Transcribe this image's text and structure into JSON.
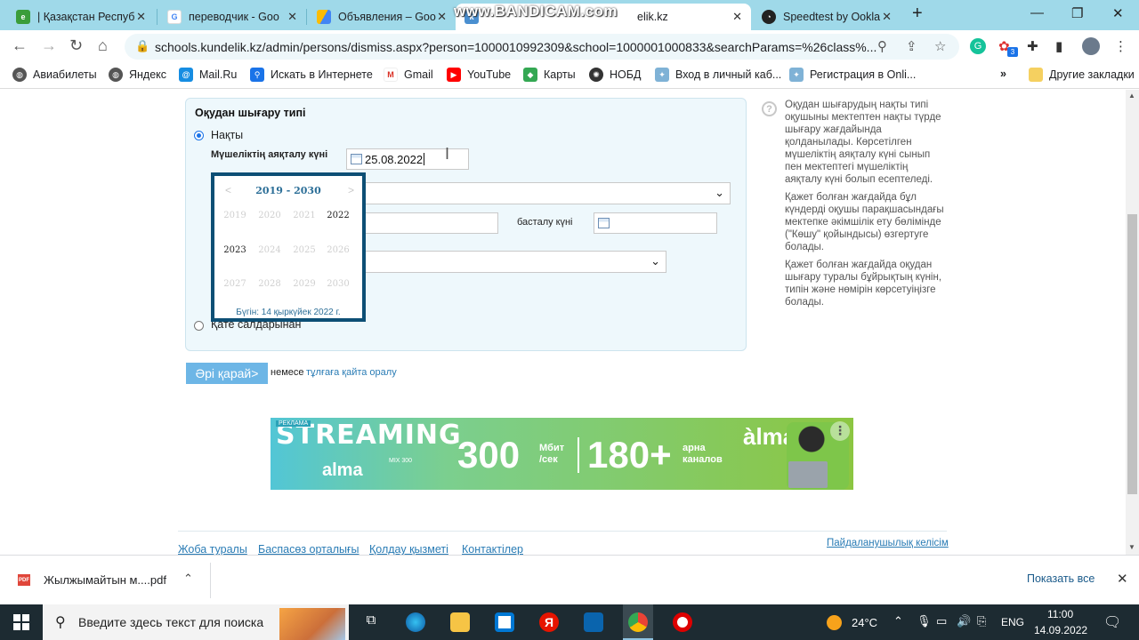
{
  "browser": {
    "tabs": [
      {
        "title": "| Қазақстан Респуб",
        "favicon": "egov-icon"
      },
      {
        "title": "переводчик - Goo",
        "favicon": "google-icon"
      },
      {
        "title": "Объявления – Goo",
        "favicon": "google-ads-icon"
      },
      {
        "title": "elik.kz",
        "favicon": "kundelik-icon"
      },
      {
        "title": "Speedtest by Ookla",
        "favicon": "speedtest-icon"
      }
    ],
    "new_tab": "+",
    "url": "schools.kundelik.kz/admin/persons/dismiss.aspx?person=1000010992309&school=1000001000833&searchParams=%26class%...",
    "extension_badge": "3",
    "bookmarks": [
      "Авиабилеты",
      "Яндекс",
      "Mail.Ru",
      "Искать в Интернете",
      "Gmail",
      "YouTube",
      "Карты",
      "НОБД",
      "Вход в личный каб...",
      "Регистрация в Onli..."
    ],
    "bookmarks_more": "»",
    "other_bookmarks": "Другие закладки"
  },
  "watermark": "www.BANDICAM.com",
  "form": {
    "section_title": "Оқудан шығару типі",
    "option_actual": "Нақты",
    "end_date_label": "Мүшеліктің аяқталу күні",
    "end_date_value": "25.08.2022",
    "start_date_label": "басталу күні",
    "start_date_value": "",
    "option_error": "Қате салдарынан",
    "next_button": "Әрі қарай>",
    "or_text": "немесе",
    "back_link": "тұлғаға қайта оралу"
  },
  "calendar": {
    "range": "2019 - 2030",
    "prev": "<",
    "next": ">",
    "years": [
      "2019",
      "2020",
      "2021",
      "2022",
      "2023",
      "2024",
      "2025",
      "2026",
      "2027",
      "2028",
      "2029",
      "2030"
    ],
    "active_years": [
      "2022",
      "2023"
    ],
    "today": "Бүгін: 14 қыркүйек 2022 г."
  },
  "help": [
    "Оқудан шығарудың нақты типі оқушыны мектептен нақты түрде шығару жағдайында қолданылады. Көрсетілген мүшеліктің аяқталу күні сынып пен мектептегі мүшеліктің аяқталу күні болып есептеледі.",
    "Қажет болған жағдайда бұл күндерді оқушы парақшасындағы мектепке әкімшілік ету бөлімінде (\"Көшу\" қойындысы) өзгертуге болады.",
    "Қажет болған жағдайда оқудан шығару туралы бұйрықтың күнін, типін және нөмірін көрсетуіңізге болады."
  ],
  "ad": {
    "tag": "РЕКЛАМА",
    "headline": "STREAMING",
    "brand": "alma",
    "mix": "MIX 300",
    "speed_value": "300",
    "speed_unit_1": "Мбит",
    "speed_unit_2": "/сек",
    "channels_value": "180+",
    "channels_unit_1": "арна",
    "channels_unit_2": "каналов",
    "brand2": "àlma"
  },
  "footer": {
    "links": [
      "Жоба туралы",
      "Баспасөз орталығы",
      "Қолдау қызметі",
      "Контактілер"
    ],
    "agreement": "Пайдаланушылық келісім"
  },
  "download": {
    "filename": "Жылжымайтын м....pdf",
    "show_all": "Показать все"
  },
  "taskbar": {
    "search_placeholder": "Введите здесь текст для поиска",
    "temperature": "24°C",
    "language": "ENG",
    "time": "11:00",
    "date": "14.09.2022"
  },
  "colors": {
    "tabstrip": "#9fd9e9",
    "panel": "#eef8fc",
    "calendar_border": "#0d4f75",
    "next_button": "#6db6e6",
    "link": "#2a7cb5"
  }
}
